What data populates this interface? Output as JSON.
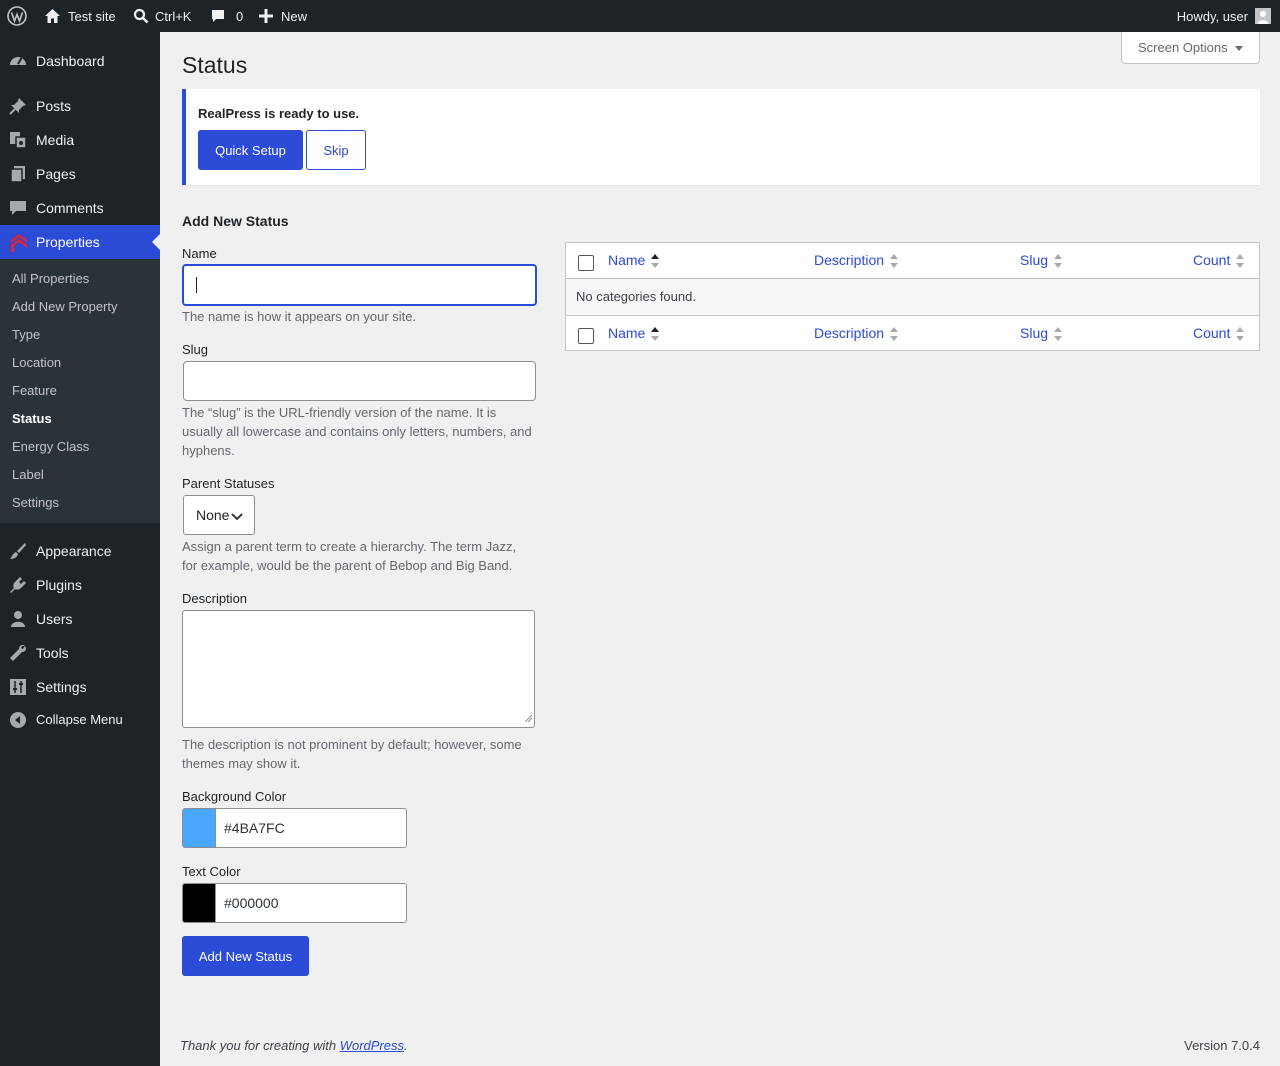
{
  "admin_bar": {
    "site_name": "Test site",
    "search_shortcut": "Ctrl+K",
    "comments_count": "0",
    "new_label": "New",
    "greeting": "Howdy, user"
  },
  "sidebar": {
    "items": [
      {
        "label": "Dashboard",
        "icon": "dashboard-icon"
      },
      {
        "label": "Posts",
        "icon": "pin-icon"
      },
      {
        "label": "Media",
        "icon": "media-icon"
      },
      {
        "label": "Pages",
        "icon": "pages-icon"
      },
      {
        "label": "Comments",
        "icon": "comment-icon"
      },
      {
        "label": "Properties",
        "icon": "realpress-icon"
      },
      {
        "label": "Appearance",
        "icon": "brush-icon"
      },
      {
        "label": "Plugins",
        "icon": "plug-icon"
      },
      {
        "label": "Users",
        "icon": "user-icon"
      },
      {
        "label": "Tools",
        "icon": "wrench-icon"
      },
      {
        "label": "Settings",
        "icon": "sliders-icon"
      },
      {
        "label": "Collapse Menu",
        "icon": "collapse-icon"
      }
    ],
    "submenu": [
      "All Properties",
      "Add New Property",
      "Type",
      "Location",
      "Feature",
      "Status",
      "Energy Class",
      "Label",
      "Settings"
    ],
    "current_submenu": "Status"
  },
  "page": {
    "title": "Status",
    "screen_options": "Screen Options"
  },
  "notice": {
    "text": "RealPress is ready to use.",
    "primary_button": "Quick Setup",
    "secondary_button": "Skip"
  },
  "form": {
    "title": "Add New Status",
    "name_label": "Name",
    "name_value": "",
    "name_help": "The name is how it appears on your site.",
    "slug_label": "Slug",
    "slug_value": "",
    "slug_help": "The “slug” is the URL-friendly version of the name. It is usually all lowercase and contains only letters, numbers, and hyphens.",
    "parent_label": "Parent Statuses",
    "parent_value": "None",
    "parent_help": "Assign a parent term to create a hierarchy. The term Jazz, for example, would be the parent of Bebop and Big Band.",
    "description_label": "Description",
    "description_value": "",
    "description_help": "The description is not prominent by default; however, some themes may show it.",
    "bg_color_label": "Background Color",
    "bg_color_value": "#4BA7FC",
    "text_color_label": "Text Color",
    "text_color_value": "#000000",
    "submit": "Add New Status"
  },
  "table": {
    "columns": [
      "Name",
      "Description",
      "Slug",
      "Count"
    ],
    "empty_text": "No categories found."
  },
  "footer": {
    "thanks_prefix": "Thank you for creating with ",
    "thanks_link": "WordPress",
    "thanks_suffix": ".",
    "version": "Version 7.0.4"
  },
  "colors": {
    "accent": "#2c4bd6",
    "sidebar_bg": "#1d2327",
    "submenu_bg": "#2c3338",
    "page_bg": "#f0f0f1"
  }
}
